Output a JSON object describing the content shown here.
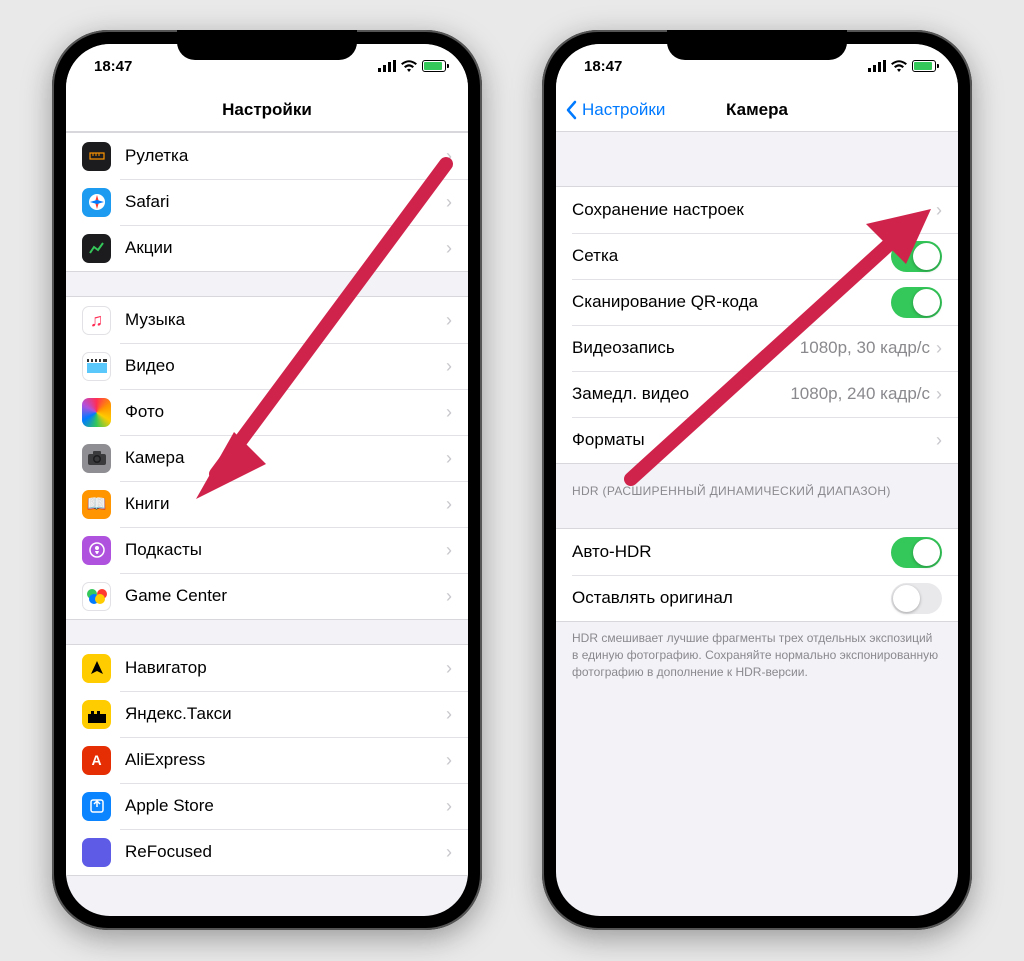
{
  "status": {
    "time": "18:47"
  },
  "phone1": {
    "title": "Настройки",
    "groups": [
      [
        {
          "icon": "ruler",
          "bg": "#1c1c1e",
          "label": "Рулетка"
        },
        {
          "icon": "safari",
          "bg": "#1d9bf0",
          "label": "Safari"
        },
        {
          "icon": "stocks",
          "bg": "#1c1c1e",
          "label": "Акции"
        }
      ],
      [
        {
          "icon": "music",
          "bg": "#ffffff",
          "label": "Музыка"
        },
        {
          "icon": "video",
          "bg": "#ffffff",
          "label": "Видео"
        },
        {
          "icon": "photos",
          "bg": "linear",
          "label": "Фото"
        },
        {
          "icon": "camera",
          "bg": "#8e8e93",
          "label": "Камера"
        },
        {
          "icon": "books",
          "bg": "#ff9500",
          "label": "Книги"
        },
        {
          "icon": "podcasts",
          "bg": "#af52de",
          "label": "Подкасты"
        },
        {
          "icon": "gamecenter",
          "bg": "#ffffff",
          "label": "Game Center"
        }
      ],
      [
        {
          "icon": "navigator",
          "bg": "#ffcc00",
          "label": "Навигатор"
        },
        {
          "icon": "yandextaxi",
          "bg": "#ffcc00",
          "label": "Яндекс.Такси"
        },
        {
          "icon": "aliexpress",
          "bg": "#e62e04",
          "label": "AliExpress"
        },
        {
          "icon": "appstore",
          "bg": "#0a84ff",
          "label": "Apple Store"
        },
        {
          "icon": "refocused",
          "bg": "#5e5ce6",
          "label": "ReFocused"
        }
      ]
    ]
  },
  "phone2": {
    "back": "Настройки",
    "title": "Камера",
    "rows": [
      {
        "label": "Сохранение настроек",
        "type": "nav"
      },
      {
        "label": "Сетка",
        "type": "switch",
        "on": true
      },
      {
        "label": "Сканирование QR-кода",
        "type": "switch",
        "on": true
      },
      {
        "label": "Видеозапись",
        "type": "nav",
        "detail": "1080p, 30 кадр/с"
      },
      {
        "label": "Замедл. видео",
        "type": "nav",
        "detail": "1080p, 240 кадр/с"
      },
      {
        "label": "Форматы",
        "type": "nav"
      }
    ],
    "section_header": "HDR (РАСШИРЕННЫЙ ДИНАМИЧЕСКИЙ ДИАПАЗОН)",
    "hdr_rows": [
      {
        "label": "Авто-HDR",
        "type": "switch",
        "on": true
      },
      {
        "label": "Оставлять оригинал",
        "type": "switch",
        "on": false
      }
    ],
    "footer": "HDR смешивает лучшие фрагменты трех отдельных экспозиций в единую фотографию. Сохраняйте нормально экспонированную фотографию в дополнение к HDR-версии."
  }
}
